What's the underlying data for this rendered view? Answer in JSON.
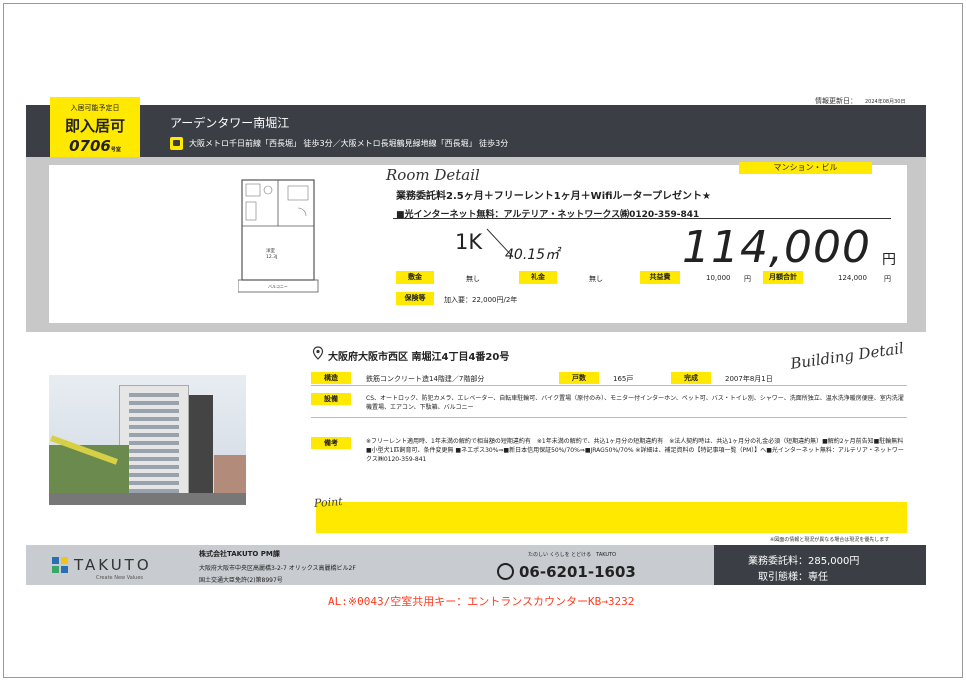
{
  "update": {
    "label": "情報更新日：",
    "date": "2024年08月30日"
  },
  "badge": {
    "line1": "入居可能予定日",
    "line2": "即入居可",
    "room": "0706",
    "room_suffix": "号室"
  },
  "building": {
    "name": "アーデンタワー南堀江",
    "stations": "大阪メトロ千日前線「西長堀」 徒歩3分／大阪メトロ長堀鶴見緑地線「西長堀」 徒歩3分"
  },
  "room": {
    "section_title": "Room Detail",
    "type_tag": "マンション・ビル",
    "promo": "業務委託料2.5ヶ月＋フリーレント1ヶ月＋Wifiルータープレゼント★",
    "internet": "■光インターネット無料：アルテリア・ネットワークス㈱0120-359-841",
    "layout": "1K",
    "area": "40.15㎡",
    "rent": "114,000",
    "rent_unit": "円",
    "floorplan_room_label": "洋室",
    "floorplan_size": "12.3J",
    "floorplan_balcony": "バルコニー"
  },
  "fees": {
    "deposit_label": "敷金",
    "deposit": "無し",
    "key_label": "礼金",
    "key": "無し",
    "common_label": "共益費",
    "common": "10,000",
    "common_unit": "円",
    "monthly_label": "月額合計",
    "monthly": "124,000",
    "monthly_unit": "円",
    "guarantee_label": "保険等",
    "guarantee": "加入要：22,000円/2年"
  },
  "building_detail": {
    "section_title": "Building Detail",
    "address": "大阪府大阪市西区 南堀江4丁目4番20号",
    "structure_label": "構造",
    "structure": "鉄筋コンクリート造14階建／7階部分",
    "units_label": "戸数",
    "units": "165戸",
    "built_label": "完成",
    "built": "2007年8月1日",
    "equipment_label": "設備",
    "equipment": "CS、オートロック、防犯カメラ、エレベーター、自転車駐輪可、バイク置場（原付のみ）、モニター付インターホン、ペット可、バス・トイレ別、シャワー、洗面所独立、温水洗浄暖房便座、室内洗濯機置場、エアコン、下駄箱、バルコニー",
    "notes_label": "備考",
    "notes": "※フリーレント適用時、1年未満の解約で相当額の短期違約有　※1年未満の解約で、共込1ヶ月分の短期違約有　※法人契約時は、共込1ヶ月分の礼金必須（短期違約無）■解約2ヶ月前告知■駐輪無料 ■小型犬1匹飼育可、条件変更無 ■ネエポス30%⇒■新日本信用保証50%/70%⇒■JRAG50%/70% ※詳細は、補足資料の【特記事項一覧（PM）】へ■光インターネット無料：アルテリア・ネットワークス㈱0120-359-841"
  },
  "point": {
    "label": "Point"
  },
  "disclaimer": "※図面の情報と現況が異なる場合は現況を優先します",
  "footer": {
    "logo": "TAKUTO",
    "logo_sub": "Create New Values",
    "company": "株式会社TAKUTO PM課",
    "address": "大阪府大阪市中央区高麗橋3-2-7 オリックス高麗橋ビル2F",
    "license": "国土交通大臣免許(2)第8997号",
    "tagline": "たのしい くらしを とどける　TAKUTO",
    "phone": "06-6201-1603",
    "fee": "業務委託料：285,000円",
    "deal": "取引態様：専任"
  },
  "al_note": "AL:※0043/空室共用キー：エントランスカウンターKB→3232",
  "colors": {
    "accent": "#ffe900",
    "header": "#3b3f45",
    "band": "#c8c8c8",
    "al": "#ff3b1f"
  }
}
